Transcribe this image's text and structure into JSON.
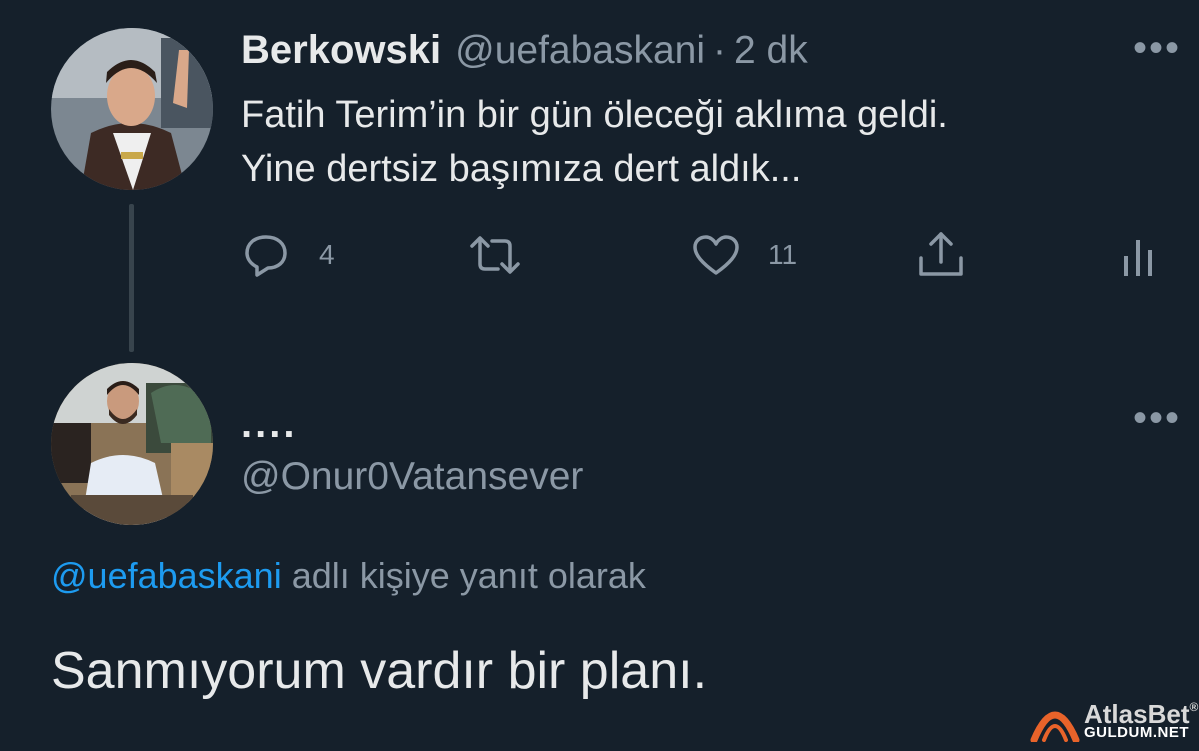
{
  "tweet": {
    "author_name": "Berkowski",
    "author_handle": "@uefabaskani",
    "separator": "·",
    "time": "2 dk",
    "more_label": "•••",
    "text_line1": "Fatih Terim’in bir gün öleceği aklıma geldi.",
    "text_line2": "Yine dertsiz başımıza dert aldık...",
    "actions": {
      "reply_icon": "comment-icon",
      "reply_count": "4",
      "retweet_icon": "retweet-icon",
      "like_icon": "heart-icon",
      "like_count": "11",
      "share_icon": "share-icon",
      "analytics_icon": "analytics-icon"
    }
  },
  "reply": {
    "author_name": "....",
    "author_handle": "@Onur0Vatansever",
    "more_label": "•••",
    "replying_to_handle": "@uefabaskani",
    "replying_to_text": "adlı kişiye yanıt olarak",
    "text": "Sanmıyorum vardır bir planı."
  },
  "watermark": {
    "brand": "AtlasBet",
    "registered": "®",
    "site": "GULDUM.NET"
  },
  "colors": {
    "background": "#15202b",
    "text": "#e7e9ea",
    "muted": "#8b98a5",
    "accent": "#1d9bf0",
    "watermark": "#e8632a"
  }
}
